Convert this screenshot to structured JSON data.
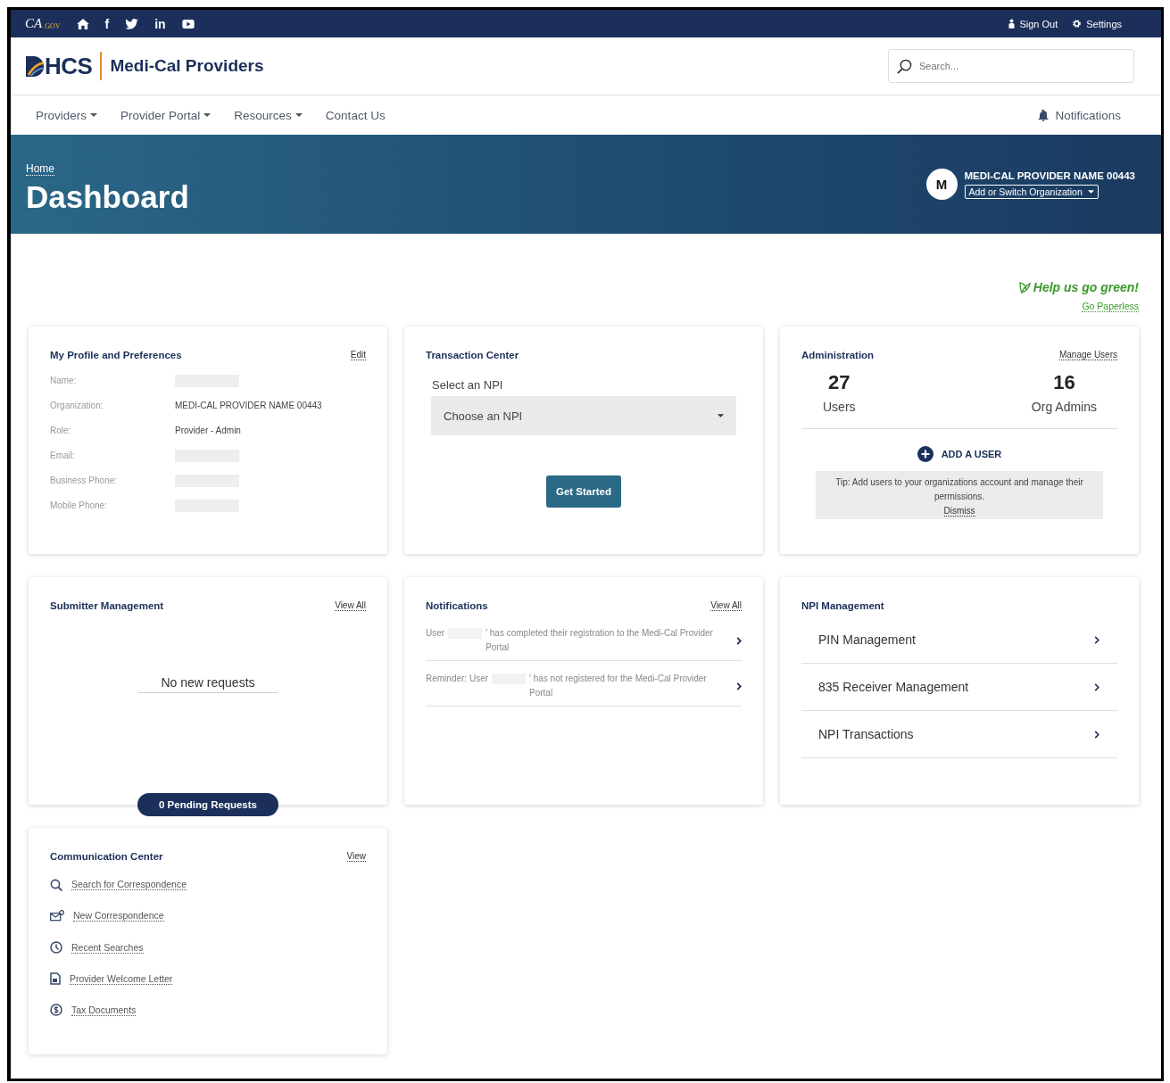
{
  "top_bar": {
    "logo": {
      "main": "CA",
      "sub": ".GOV"
    },
    "social": [
      {
        "kind": "home"
      },
      {
        "kind": "facebook",
        "glyph": "f"
      },
      {
        "kind": "twitter"
      },
      {
        "kind": "linkedin",
        "glyph": "in"
      },
      {
        "kind": "youtube"
      }
    ],
    "links": [
      {
        "kind": "user",
        "label": "Sign Out"
      },
      {
        "kind": "gear",
        "label": "Settings"
      }
    ]
  },
  "header": {
    "brand": "HCS",
    "site_name": "Medi-Cal Providers",
    "search": {
      "placeholder": "Search..."
    }
  },
  "nav": {
    "items": [
      {
        "label": "Providers",
        "dropdown": true
      },
      {
        "label": "Provider Portal",
        "dropdown": true
      },
      {
        "label": "Resources",
        "dropdown": true
      },
      {
        "label": "Contact Us",
        "dropdown": false
      }
    ],
    "notifications": "Notifications"
  },
  "hero": {
    "breadcrumb": "Home",
    "title": "Dashboard",
    "avatar": "M",
    "org_name": "MEDI-CAL PROVIDER NAME 00443",
    "switch_button": "Add or Switch Organization"
  },
  "green": {
    "headline": "Help us go green!",
    "link": "Go Paperless"
  },
  "profile": {
    "title": "My Profile and Preferences",
    "action": "Edit",
    "fields": [
      {
        "label": "Name:",
        "redacted": true
      },
      {
        "label": "Organization:",
        "value": "MEDI-CAL PROVIDER NAME 00443",
        "redacted": false
      },
      {
        "label": "Role:",
        "value": "Provider - Admin",
        "redacted": false
      },
      {
        "label": "Email:",
        "redacted": true
      },
      {
        "label": "Business Phone:",
        "redacted": true
      },
      {
        "label": "Mobile Phone:",
        "redacted": true
      }
    ]
  },
  "transaction": {
    "title": "Transaction Center",
    "select_label": "Select an NPI",
    "select_value": "Choose an NPI",
    "button": "Get Started"
  },
  "administration": {
    "title": "Administration",
    "action": "Manage Users",
    "stats": [
      {
        "value": "27",
        "label": "Users"
      },
      {
        "value": "16",
        "label": "Org Admins"
      }
    ],
    "add_button": "ADD A USER",
    "tip": "Tip: Add users to your organizations account and manage their permissions.",
    "dismiss": "Dismiss"
  },
  "submitter": {
    "title": "Submitter Management",
    "action": "View All",
    "empty": "No new requests",
    "pending": "0 Pending Requests"
  },
  "notifications": {
    "title": "Notifications",
    "action": "View All",
    "items": [
      {
        "lead": "User",
        "text": "' has completed their registration to the Medi-Cal Provider Portal"
      },
      {
        "lead": "Reminder: User",
        "text": "' has not registered for the Medi-Cal Provider Portal"
      }
    ]
  },
  "npi": {
    "title": "NPI Management",
    "items": [
      "PIN Management",
      "835 Receiver Management",
      "NPI Transactions"
    ]
  },
  "communication": {
    "title": "Communication Center",
    "action": "View",
    "items": [
      {
        "kind": "search",
        "label": "Search for Correspondence"
      },
      {
        "kind": "mail",
        "label": "New Correspondence"
      },
      {
        "kind": "clock",
        "label": "Recent Searches"
      },
      {
        "kind": "document",
        "label": "Provider Welcome Letter"
      },
      {
        "kind": "dollar",
        "label": "Tax Documents"
      }
    ]
  }
}
